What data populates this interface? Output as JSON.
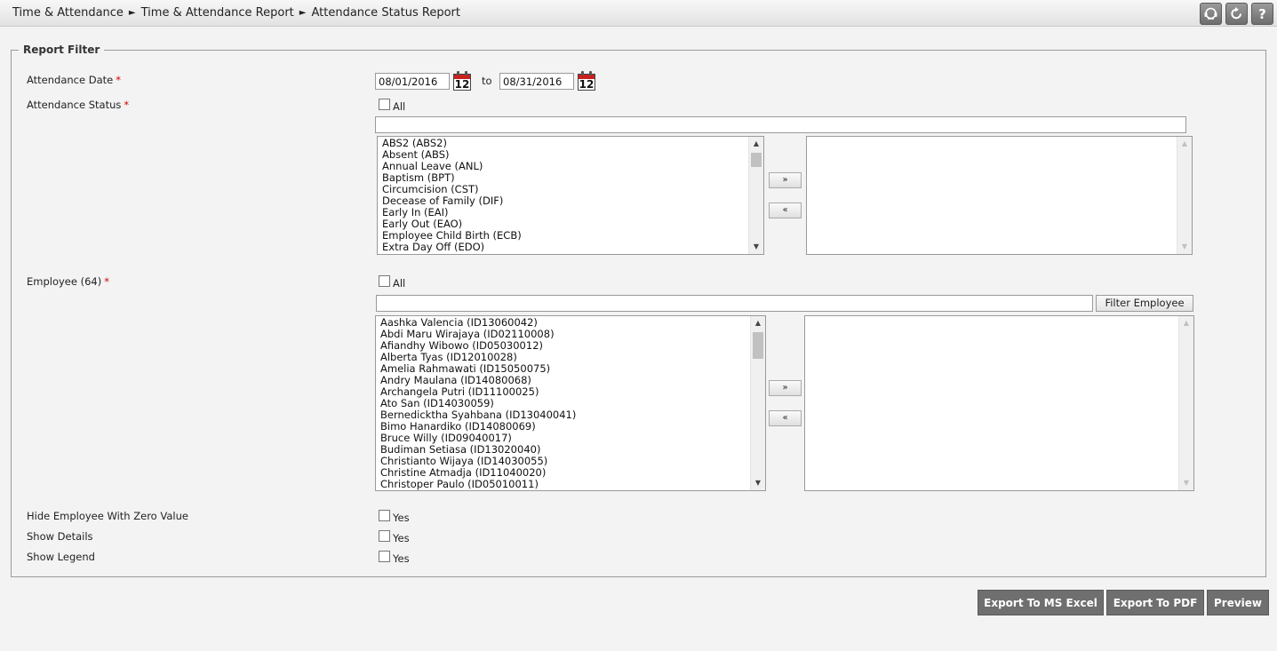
{
  "breadcrumb": [
    "Time & Attendance",
    "Time & Attendance Report",
    "Attendance Status Report"
  ],
  "breadcrumb_separator": "►",
  "toolbar_icons": [
    "support-icon",
    "refresh-icon",
    "help-icon"
  ],
  "filter": {
    "legend": "Report Filter",
    "attendance_date": {
      "label": "Attendance Date",
      "required_mark": "*",
      "from": "08/01/2016",
      "to_label": "to",
      "to": "08/31/2016",
      "calendar_day": "12"
    },
    "attendance_status": {
      "label": "Attendance Status",
      "required_mark": "*",
      "all_label": "All",
      "all_checked": false,
      "search_value": "",
      "available": [
        "ABS2 (ABS2)",
        "Absent (ABS)",
        "Annual Leave (ANL)",
        "Baptism (BPT)",
        "Circumcision (CST)",
        "Decease of Family (DIF)",
        "Early In (EAI)",
        "Early Out (EAO)",
        "Employee Child Birth (ECB)",
        "Extra Day Off (EDO)"
      ],
      "selected": [],
      "add_label": "»",
      "remove_label": "«"
    },
    "employee": {
      "label": "Employee (64)",
      "required_mark": "*",
      "all_label": "All",
      "all_checked": false,
      "search_value": "",
      "filter_button": "Filter Employee",
      "available": [
        "Aashka Valencia (ID13060042)",
        "Abdi Maru Wirajaya (ID02110008)",
        "Afiandhy Wibowo (ID05030012)",
        "Alberta Tyas (ID12010028)",
        "Amelia Rahmawati (ID15050075)",
        "Andry Maulana (ID14080068)",
        "Archangela Putri (ID11100025)",
        "Ato San (ID14030059)",
        "Bernedicktha Syahbana (ID13040041)",
        "Bimo Hanardiko (ID14080069)",
        "Bruce Willy (ID09040017)",
        "Budiman Setiasa (ID13020040)",
        "Christianto Wijaya (ID14030055)",
        "Christine Atmadja (ID11040020)",
        "Christoper Paulo (ID05010011)"
      ],
      "selected": [],
      "add_label": "»",
      "remove_label": "«"
    },
    "options": [
      {
        "label": "Hide Employee With Zero Value",
        "check_label": "Yes",
        "checked": false
      },
      {
        "label": "Show Details",
        "check_label": "Yes",
        "checked": false
      },
      {
        "label": "Show Legend",
        "check_label": "Yes",
        "checked": false
      }
    ]
  },
  "actions": {
    "export_excel": "Export To MS Excel",
    "export_pdf": "Export To PDF",
    "preview": "Preview"
  },
  "colors": {
    "required": "#d40000",
    "action_button": "#6f6f6f",
    "calendar_header": "#c9201f"
  }
}
